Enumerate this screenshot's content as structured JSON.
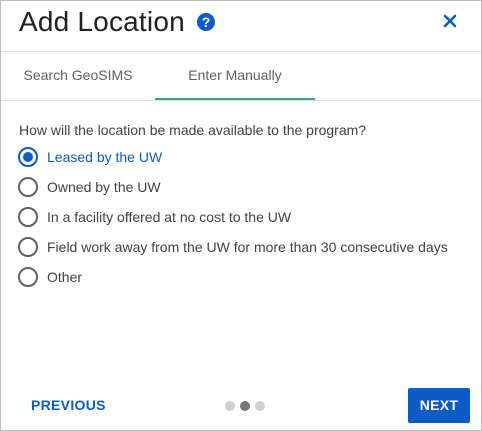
{
  "dialog": {
    "title": "Add Location",
    "help_icon": "help-circle-icon",
    "help_glyph": "?",
    "close_icon": "close-icon"
  },
  "tabs": [
    {
      "label": "Search GeoSIMS",
      "active": false
    },
    {
      "label": "Enter Manually",
      "active": true
    }
  ],
  "form": {
    "question": "How will the location be made available to the program?",
    "options": [
      {
        "label": "Leased by the UW",
        "selected": true
      },
      {
        "label": "Owned by the UW",
        "selected": false
      },
      {
        "label": "In a facility offered at no cost to the UW",
        "selected": false
      },
      {
        "label": "Field work away from the UW for more than 30 consecutive days",
        "selected": false
      },
      {
        "label": "Other",
        "selected": false
      }
    ]
  },
  "footer": {
    "previous_label": "PREVIOUS",
    "next_label": "NEXT",
    "step_current": 2,
    "step_total": 3
  },
  "colors": {
    "accent": "#0b5cc9",
    "tab_indicator": "#3aa67f"
  }
}
